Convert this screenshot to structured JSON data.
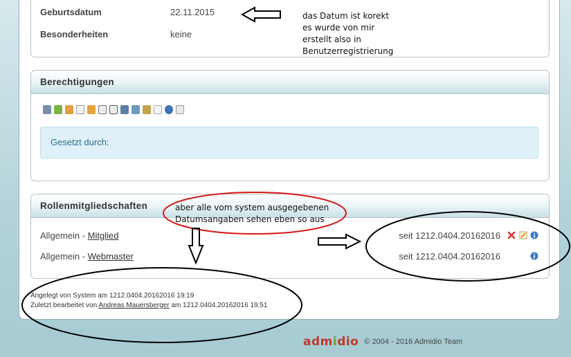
{
  "profile": {
    "birthdate_label": "Geburtsdatum",
    "birthdate_value": "22.11.2015",
    "special_label": "Besonderheiten",
    "special_value": "keine"
  },
  "permissions": {
    "title": "Berechtigungen",
    "set_by": "Gesetzt durch:"
  },
  "roles": {
    "title": "Rollenmitgliedschaften",
    "items": [
      {
        "category": "Allgemein",
        "separator": " - ",
        "role": "Mitglied",
        "since": "seit 1212.0404.20162016"
      },
      {
        "category": "Allgemein",
        "separator": " - ",
        "role": "Webmaster",
        "since": "seit 1212.0404.20162016"
      }
    ]
  },
  "meta": {
    "created_text": "Angelegt von System am 1212.0404.20162016 19:19",
    "edited_prefix": "Zuletzt bearbeitet von ",
    "edited_user": "Andreas Mauersberger",
    "edited_suffix": " am 1212.0404.20162016 19:51"
  },
  "footer": {
    "logo_main": "adm",
    "logo_accent": "i",
    "logo_rest": "dio",
    "copyright": "© 2004 - 2016  Admidio Team"
  },
  "annotations": {
    "note1_lines": [
      "das Datum ist korekt",
      "es wurde von mir",
      "erstellt also in",
      "Benutzerregistrierung"
    ],
    "note2_lines": [
      "aber alle vom system ausgegebenen",
      "Datumsangaben sehen eben so aus"
    ]
  },
  "colors": {
    "ellipse_red": "#d81818",
    "ellipse_black": "#000000",
    "info_blue": "#3a78c8",
    "delete_red": "#e03030"
  }
}
